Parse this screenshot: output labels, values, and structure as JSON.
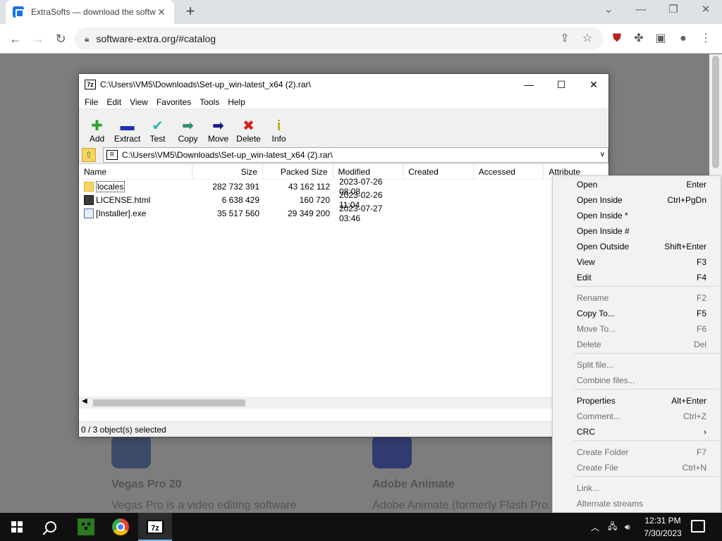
{
  "browser": {
    "tab_title": "ExtraSofts — download the softw",
    "tab_close": "✕",
    "new_tab": "+",
    "url": "software-extra.org/#catalog",
    "back": "←",
    "forward": "→",
    "reload": "↻",
    "win_minimize": "—",
    "win_restore": "❐",
    "win_close": "✕",
    "win_dropdown": "⌄"
  },
  "page": {
    "blur_title_1": "Vegas Pro 20",
    "blur_desc_1": "Vegas Pro is a video editing software",
    "blur_title_2": "Adobe Animate",
    "blur_desc_2": "Adobe Animate (formerly Flash Pro..."
  },
  "sevenzip": {
    "title": "C:\\Users\\VM5\\Downloads\\Set-up_win-latest_x64 (2).rar\\",
    "icon_text": "7z",
    "menu": [
      "File",
      "Edit",
      "View",
      "Favorites",
      "Tools",
      "Help"
    ],
    "toolbar": [
      {
        "label": "Add",
        "glyph": "✚",
        "color": "#2ea02e"
      },
      {
        "label": "Extract",
        "glyph": "▬",
        "color": "#1f2fb8"
      },
      {
        "label": "Test",
        "glyph": "✔",
        "color": "#2fb8b8"
      },
      {
        "label": "Copy",
        "glyph": "➡",
        "color": "#2f8f6f"
      },
      {
        "label": "Move",
        "glyph": "➡",
        "color": "#1a1a8a"
      },
      {
        "label": "Delete",
        "glyph": "✖",
        "color": "#d42020"
      },
      {
        "label": "Info",
        "glyph": "i",
        "color": "#c9a400"
      }
    ],
    "path": "C:\\Users\\VM5\\Downloads\\Set-up_win-latest_x64 (2).rar\\",
    "columns": [
      "Name",
      "Size",
      "Packed Size",
      "Modified",
      "Created",
      "Accessed",
      "Attribute"
    ],
    "rows": [
      {
        "name": "locales",
        "type": "folder",
        "size": "282 732 391",
        "packed": "43 162 112",
        "modified": "2023-07-26 08:08"
      },
      {
        "name": "LICENSE.html",
        "type": "html",
        "size": "6 638 429",
        "packed": "160 720",
        "modified": "2023-02-26 11:04"
      },
      {
        "name": "[Installer].exe",
        "type": "exe",
        "size": "35 517 560",
        "packed": "29 349 200",
        "modified": "2023-07-27 03:46"
      }
    ],
    "status": "0 / 3 object(s) selected"
  },
  "context_menu": [
    {
      "label": "Open",
      "shortcut": "Enter",
      "disabled": false
    },
    {
      "label": "Open Inside",
      "shortcut": "Ctrl+PgDn",
      "disabled": false
    },
    {
      "label": "Open Inside *",
      "shortcut": "",
      "disabled": false
    },
    {
      "label": "Open Inside #",
      "shortcut": "",
      "disabled": false
    },
    {
      "label": "Open Outside",
      "shortcut": "Shift+Enter",
      "disabled": false
    },
    {
      "label": "View",
      "shortcut": "F3",
      "disabled": false
    },
    {
      "label": "Edit",
      "shortcut": "F4",
      "disabled": false
    },
    {
      "label": "Rename",
      "shortcut": "F2",
      "disabled": true
    },
    {
      "label": "Copy To...",
      "shortcut": "F5",
      "disabled": false
    },
    {
      "label": "Move To...",
      "shortcut": "F6",
      "disabled": true
    },
    {
      "label": "Delete",
      "shortcut": "Del",
      "disabled": true
    },
    {
      "label": "Split file...",
      "shortcut": "",
      "disabled": true
    },
    {
      "label": "Combine files...",
      "shortcut": "",
      "disabled": true
    },
    {
      "label": "Properties",
      "shortcut": "Alt+Enter",
      "disabled": false
    },
    {
      "label": "Comment...",
      "shortcut": "Ctrl+Z",
      "disabled": true
    },
    {
      "label": "CRC",
      "shortcut": "›",
      "disabled": false
    },
    {
      "label": "Create Folder",
      "shortcut": "F7",
      "disabled": true
    },
    {
      "label": "Create File",
      "shortcut": "Ctrl+N",
      "disabled": true
    },
    {
      "label": "Link...",
      "shortcut": "",
      "disabled": true
    },
    {
      "label": "Alternate streams",
      "shortcut": "",
      "disabled": true
    }
  ],
  "taskbar": {
    "time": "12:31 PM",
    "date": "7/30/2023",
    "z7_label": "7z"
  }
}
